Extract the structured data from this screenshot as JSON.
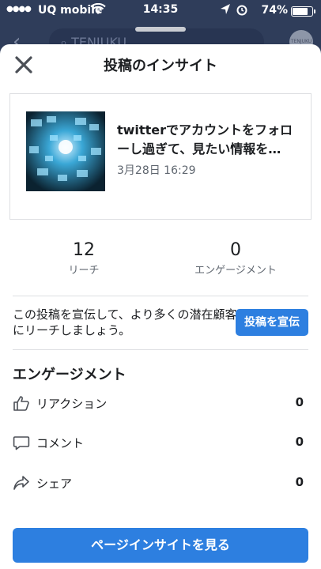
{
  "status_bar": {
    "carrier": "UQ mobile",
    "time": "14:35",
    "battery": "74%"
  },
  "background": {
    "search_text": "TENJUKU",
    "avatar_text": "TENJUKU"
  },
  "sheet": {
    "title": "投稿のインサイト",
    "post": {
      "title": "twitterでアカウントをフォローし過ぎて、見たい情報を…",
      "date": "3月28日 16:29"
    },
    "stats": {
      "reach_value": "12",
      "reach_label": "リーチ",
      "engagement_value": "0",
      "engagement_label": "エンゲージメント"
    },
    "promo": {
      "text": "この投稿を宣伝して、より多くの潜在顧客にリーチしましょう。",
      "button": "投稿を宣伝"
    },
    "engagement": {
      "title": "エンゲージメント",
      "rows": [
        {
          "label": "リアクション",
          "value": "0",
          "icon": "thumbs-up-icon"
        },
        {
          "label": "コメント",
          "value": "0",
          "icon": "comment-icon"
        },
        {
          "label": "シェア",
          "value": "0",
          "icon": "share-icon"
        }
      ]
    },
    "cta": "ページインサイトを見る"
  },
  "colors": {
    "accent": "#2d7fe0",
    "overlay": "#2f3d5a"
  }
}
